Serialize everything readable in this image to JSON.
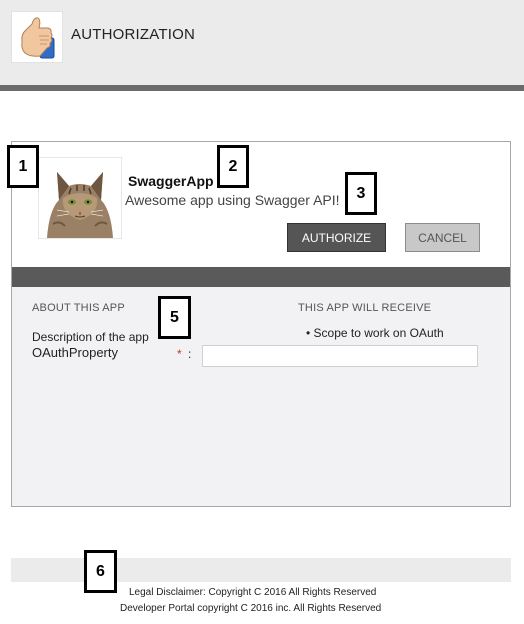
{
  "header": {
    "title": "AUTHORIZATION",
    "logo_icon": "thumbs-up-icon"
  },
  "app": {
    "avatar_icon": "cat-avatar",
    "name": "SwaggerApp",
    "description": "Awesome app using Swagger API!"
  },
  "actions": {
    "authorize_label": "AUTHORIZE",
    "cancel_label": "CANCEL"
  },
  "about": {
    "heading": "ABOUT THIS APP",
    "description_label": "Description of the app",
    "property_label": "OAuthProperty",
    "required_marker": "*",
    "colon": ":",
    "property_value": ""
  },
  "receive": {
    "heading": "THIS APP WILL RECEIVE",
    "scopes": [
      "Scope to work on OAuth"
    ]
  },
  "footer": {
    "legal": "Legal Disclaimer: Copyright C 2016 All Rights Reserved",
    "portal": "Developer Portal copyright C 2016 inc. All Rights Reserved"
  },
  "callouts": [
    "1",
    "2",
    "3",
    "5",
    "6"
  ],
  "colors": {
    "header_bg": "#ebebeb",
    "band": "#5a5a5a",
    "authorize_bg": "#555555",
    "cancel_bg": "#c8c8c8",
    "required": "#c0392b"
  }
}
